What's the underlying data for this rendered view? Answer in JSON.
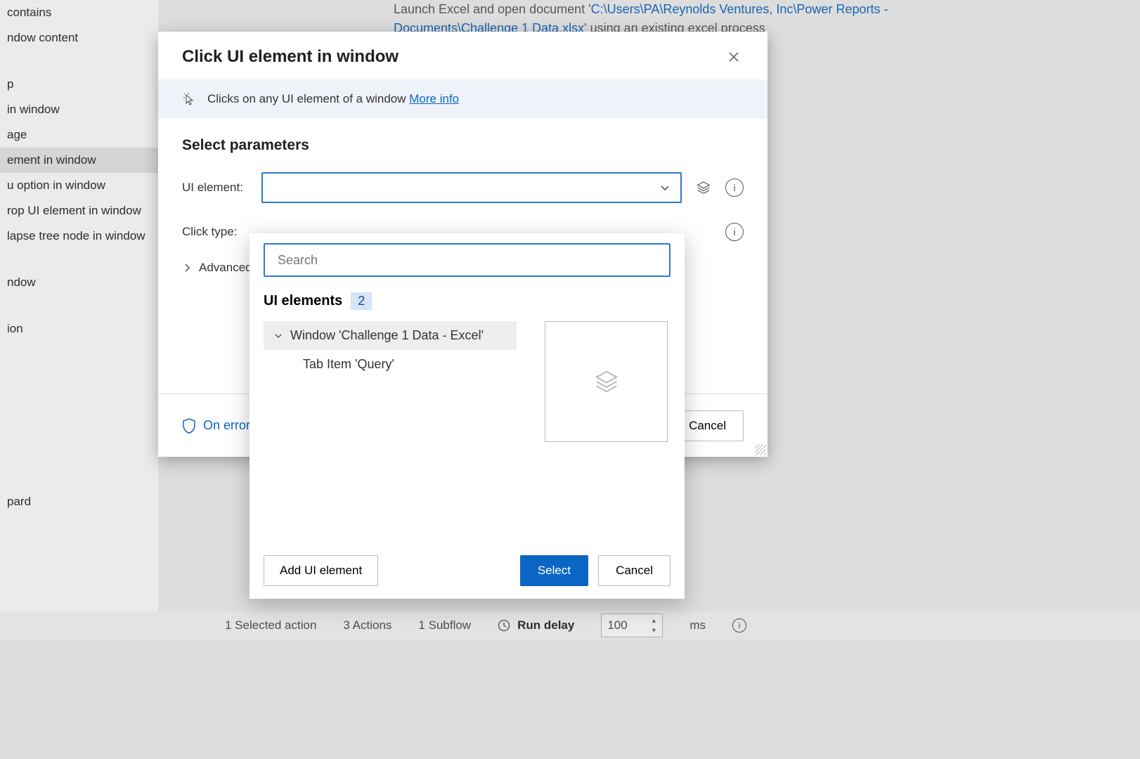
{
  "sidebar": {
    "items": [
      "contains",
      "ndow content",
      "",
      "p",
      "in window",
      "age",
      "ement in window",
      "u option in window",
      "rop UI element in window",
      "lapse tree node in window",
      "",
      "ndow",
      "",
      "ion",
      "",
      "",
      "",
      "",
      "",
      "pard"
    ],
    "selected_index": 6
  },
  "flow_step": {
    "prefix": "Launch Excel and open document '",
    "path": "C:\\Users\\PA\\Reynolds Ventures, Inc\\Power Reports - Documents\\Challenge 1 Data.xlsx",
    "suffix": "' using an existing excel process"
  },
  "dialog": {
    "title": "Click UI element in window",
    "info_text": "Clicks on any UI element of a window",
    "more_info": "More info",
    "section_title": "Select parameters",
    "labels": {
      "ui_element": "UI element:",
      "click_type": "Click type:",
      "advanced": "Advanced"
    },
    "on_error": "On error",
    "cancel": "Cancel"
  },
  "dropdown": {
    "search_placeholder": "Search",
    "heading": "UI elements",
    "count": "2",
    "tree": {
      "parent": "Window 'Challenge 1 Data - Excel'",
      "child": "Tab Item 'Query'"
    },
    "buttons": {
      "add": "Add UI element",
      "select": "Select",
      "cancel": "Cancel"
    }
  },
  "status": {
    "selected": "1 Selected action",
    "actions": "3 Actions",
    "subflow": "1 Subflow",
    "run_delay_label": "Run delay",
    "run_delay_value": "100",
    "ms": "ms"
  }
}
